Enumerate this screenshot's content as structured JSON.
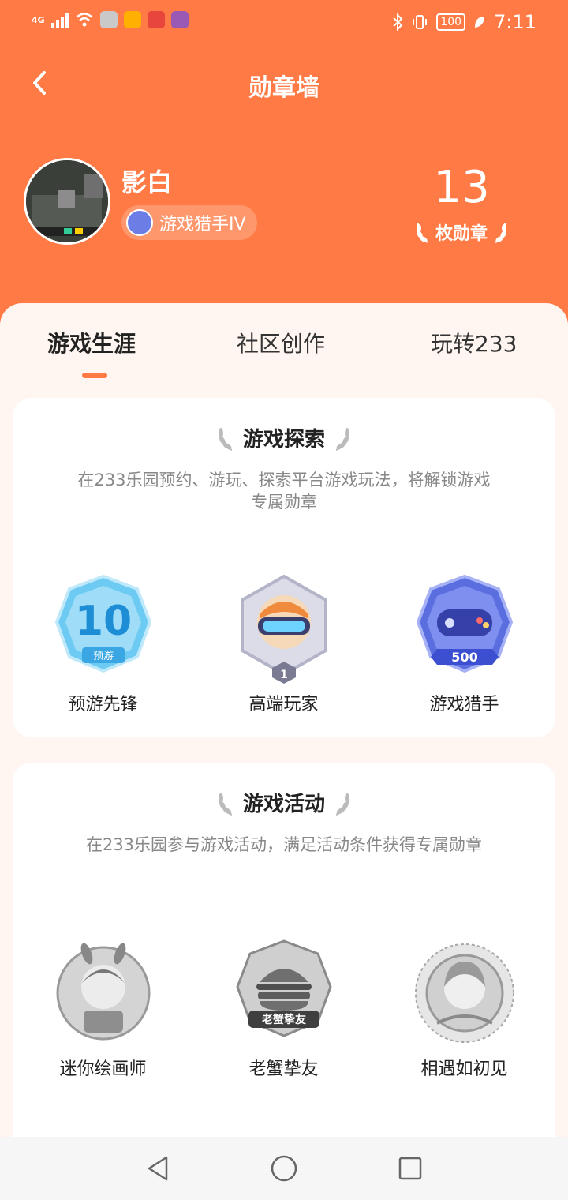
{
  "status_bar": {
    "network": "4G",
    "battery": "100",
    "time": "7:11"
  },
  "header": {
    "title": "勋章墙"
  },
  "profile": {
    "username": "影白",
    "rank_label": "游戏猎手IV",
    "badge_count": "13",
    "badge_count_label": "枚勋章"
  },
  "tabs": [
    {
      "label": "游戏生涯",
      "active": true
    },
    {
      "label": "社区创作",
      "active": false
    },
    {
      "label": "玩转233",
      "active": false
    }
  ],
  "sections": [
    {
      "title": "游戏探索",
      "description": "在233乐园预约、游玩、探索平台游戏玩法，将解锁游戏专属勋章",
      "badges": [
        {
          "name": "预游先锋",
          "icon": "preorder-10-badge-icon",
          "sub_text": "预游",
          "number": "10",
          "unlocked": true
        },
        {
          "name": "高端玩家",
          "icon": "vr-player-badge-icon",
          "number": "1",
          "unlocked": true
        },
        {
          "name": "游戏猎手",
          "icon": "gamepad-hunter-badge-icon",
          "number": "500",
          "unlocked": true
        }
      ]
    },
    {
      "title": "游戏活动",
      "description": "在233乐园参与游戏活动，满足活动条件获得专属勋章",
      "badges": [
        {
          "name": "迷你绘画师",
          "icon": "mini-painter-badge-icon",
          "unlocked": false
        },
        {
          "name": "老蟹挚友",
          "icon": "burger-friend-badge-icon",
          "sub_text": "老蟹挚友",
          "unlocked": false
        },
        {
          "name": "相遇如初见",
          "icon": "first-meet-badge-icon",
          "unlocked": false
        }
      ]
    }
  ],
  "colors": {
    "brand": "#FF7A45",
    "sheet_bg": "#FFF6F1",
    "text_primary": "#222222",
    "text_secondary": "#888888"
  }
}
